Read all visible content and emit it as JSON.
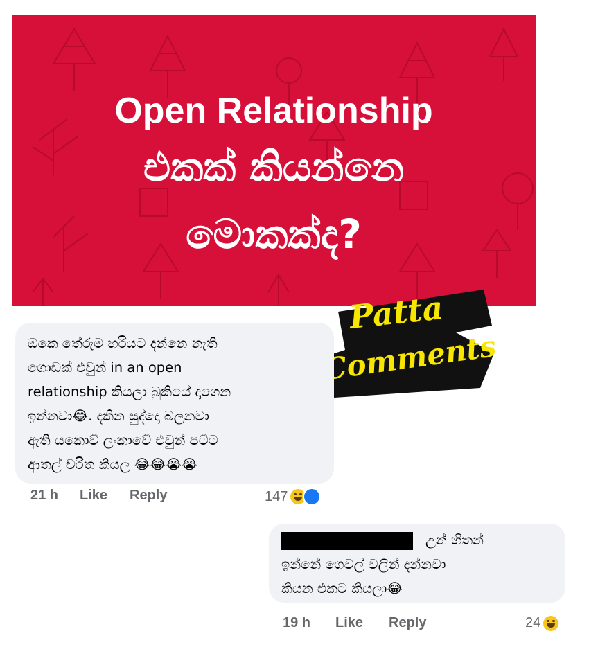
{
  "banner": {
    "line1": "Open Relationship",
    "line2": "එකක් කියන්නෙ",
    "line3": "මොකක්ද?",
    "background": "#d61039"
  },
  "sticker": {
    "line1": "Patta",
    "line2": "Comments",
    "color": "#f7e600"
  },
  "comments": [
    {
      "lines": [
        "ඔකෙ තේරුම හරියට දන්නෙ නැති",
        "ගොඩක් එවුන් in an open",
        "relationship කියලා බුකියේ දාගෙන",
        "ඉන්නවා😂. දකින සුද්දො බලනවා",
        "ඇති යකොව් ලංකාවේ එවුන් පට්ට",
        "ආතල් චරිත කියල 😂😂😭😭"
      ],
      "time": "21 h",
      "like": "Like",
      "reply": "Reply",
      "reaction_count": "147",
      "reaction_icons": [
        "haha-icon",
        "like-icon"
      ]
    },
    {
      "lines": [
        "උන් හිතන්",
        "ඉන්නේ ගෙවල් වලින් දන්නවා",
        "කියන එකට කියලා😂"
      ],
      "time": "19 h",
      "like": "Like",
      "reply": "Reply",
      "reaction_count": "24",
      "reaction_icons": [
        "haha-icon"
      ]
    }
  ]
}
